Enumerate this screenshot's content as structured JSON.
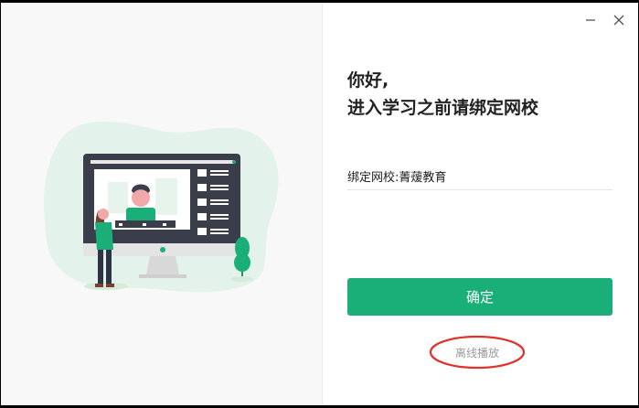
{
  "window": {
    "minimize_label": "—",
    "close_label": "×"
  },
  "greeting": {
    "line1": "你好,",
    "line2": "进入学习之前请绑定网校"
  },
  "school": {
    "label": "绑定网校:",
    "value": "菁蕿教育"
  },
  "confirm_label": "确定",
  "offline_label": "离线播放",
  "colors": {
    "accent": "#1aaf79",
    "highlight_ring": "#e03228"
  }
}
